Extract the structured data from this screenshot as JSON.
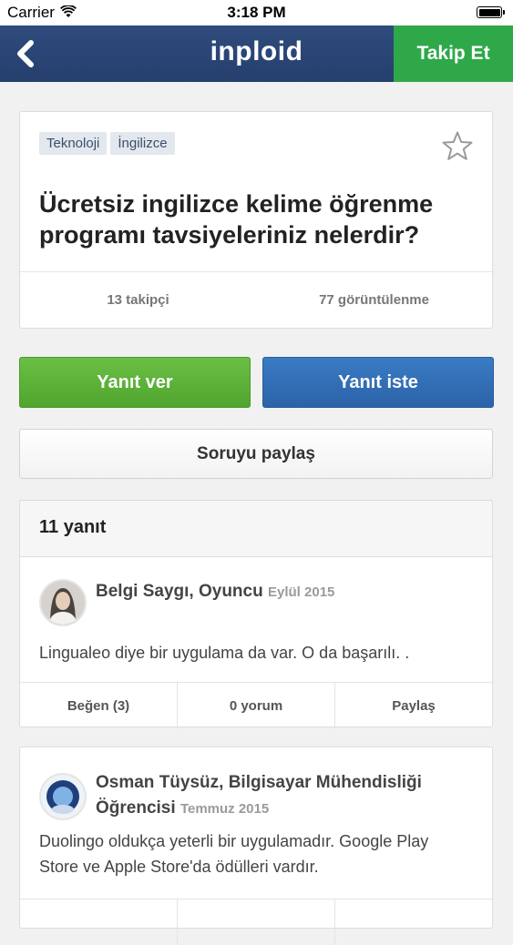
{
  "status_bar": {
    "carrier": "Carrier",
    "time": "3:18 PM"
  },
  "nav": {
    "logo": "inploid",
    "follow_label": "Takip Et",
    "colors": {
      "bar": "#2f4c7e",
      "follow": "#2fa84a"
    }
  },
  "question": {
    "tags": [
      "Teknoloji",
      "İngilizce"
    ],
    "title": "Ücretsiz ingilizce kelime öğrenme programı tavsiyeleriniz nelerdir?",
    "followers": "13 takipçi",
    "views": "77 görüntülenme"
  },
  "buttons": {
    "answer": "Yanıt ver",
    "ask_answer": "Yanıt iste",
    "share": "Soruyu paylaş"
  },
  "answers": {
    "count_label": "11 yanıt",
    "items": [
      {
        "author": "Belgi Saygı, Oyuncu",
        "date": "Eylül 2015",
        "text": "Lingualeo diye bir uygulama da var. O da başarılı. .",
        "like": "Beğen (3)",
        "comments": "0 yorum",
        "share": "Paylaş"
      },
      {
        "author": "Osman Tüysüz, Bilgisayar Mühendisliği Öğrencisi",
        "date": "Temmuz 2015",
        "text": "Duolingo oldukça yeterli bir uygulamadır. Google Play Store ve Apple Store'da ödülleri vardır."
      }
    ]
  }
}
